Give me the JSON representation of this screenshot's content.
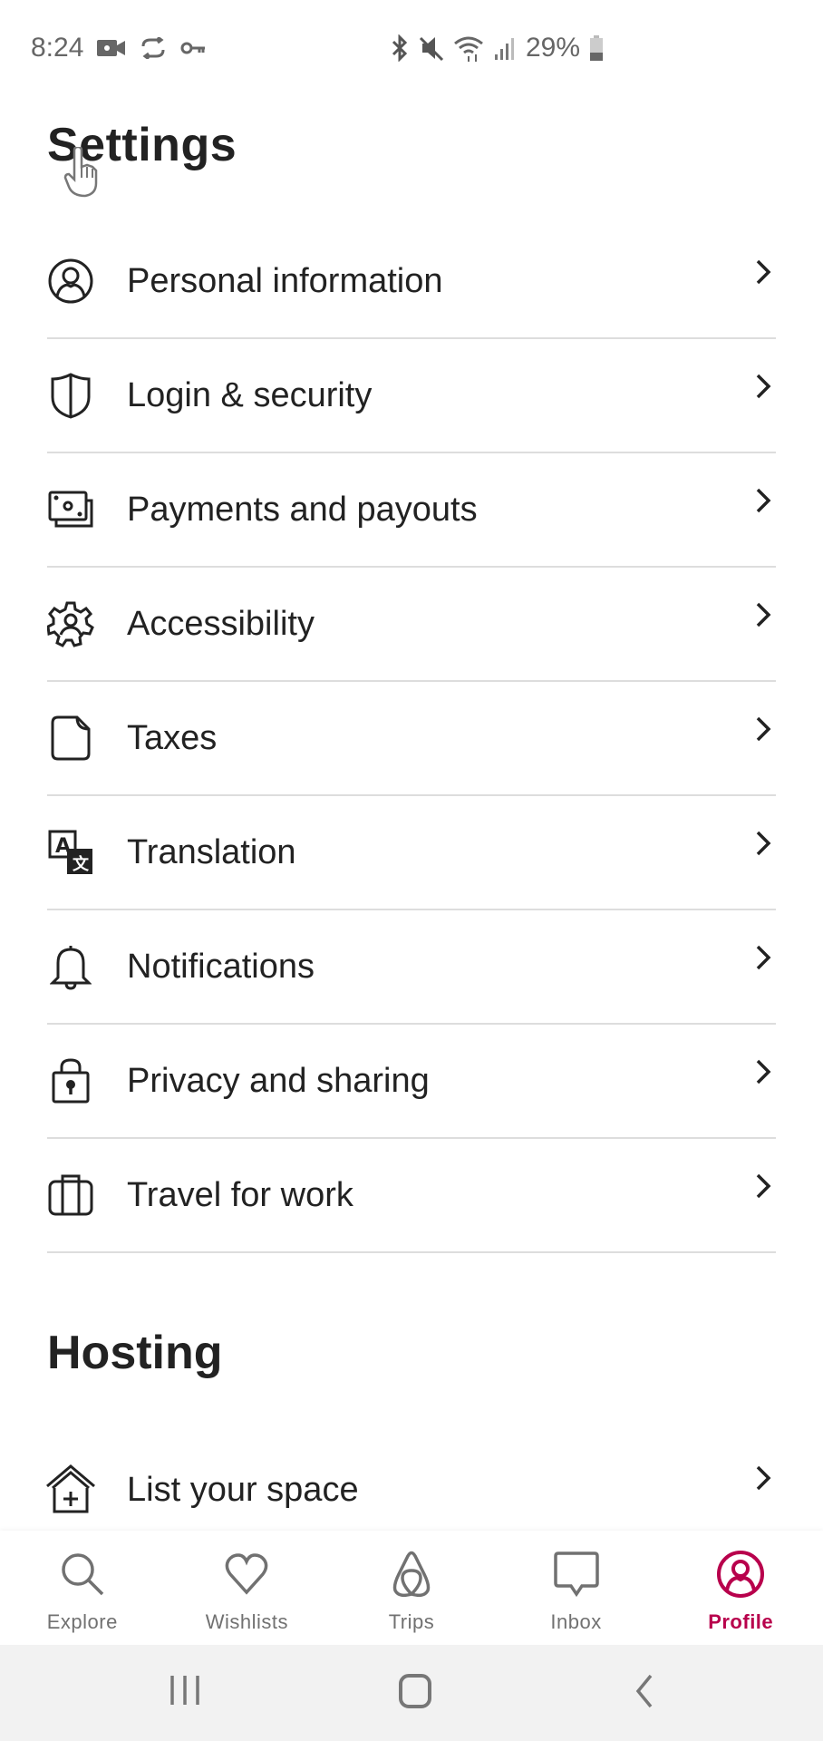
{
  "status_bar": {
    "time": "8:24",
    "battery": "29%",
    "left_icons": [
      "video-record-icon",
      "sync-check-icon",
      "vpn-key-icon"
    ],
    "right_icons": [
      "bluetooth-icon",
      "mute-icon",
      "wifi-icon",
      "signal-icon",
      "battery-icon"
    ]
  },
  "header": {
    "title": "Settings"
  },
  "settings": {
    "items": [
      {
        "label": "Personal information",
        "icon": "user-circle-icon"
      },
      {
        "label": "Login & security",
        "icon": "shield-icon"
      },
      {
        "label": "Payments and payouts",
        "icon": "money-icon"
      },
      {
        "label": "Accessibility",
        "icon": "accessibility-gear-icon"
      },
      {
        "label": "Taxes",
        "icon": "document-icon"
      },
      {
        "label": "Translation",
        "icon": "translate-icon"
      },
      {
        "label": "Notifications",
        "icon": "bell-icon"
      },
      {
        "label": "Privacy and sharing",
        "icon": "lock-icon"
      },
      {
        "label": "Travel for work",
        "icon": "suitcase-icon"
      }
    ]
  },
  "hosting": {
    "title": "Hosting",
    "items": [
      {
        "label": "List your space",
        "icon": "house-plus-icon"
      }
    ]
  },
  "tab_bar": {
    "tabs": [
      {
        "label": "Explore",
        "icon": "search-icon",
        "active": false
      },
      {
        "label": "Wishlists",
        "icon": "heart-icon",
        "active": false
      },
      {
        "label": "Trips",
        "icon": "airbnb-logo-icon",
        "active": false
      },
      {
        "label": "Inbox",
        "icon": "message-icon",
        "active": false
      },
      {
        "label": "Profile",
        "icon": "profile-icon",
        "active": true
      }
    ],
    "active_color": "#b8004c",
    "inactive_color": "#717171"
  },
  "system_nav": {
    "buttons": [
      "recent-apps",
      "home",
      "back"
    ]
  }
}
